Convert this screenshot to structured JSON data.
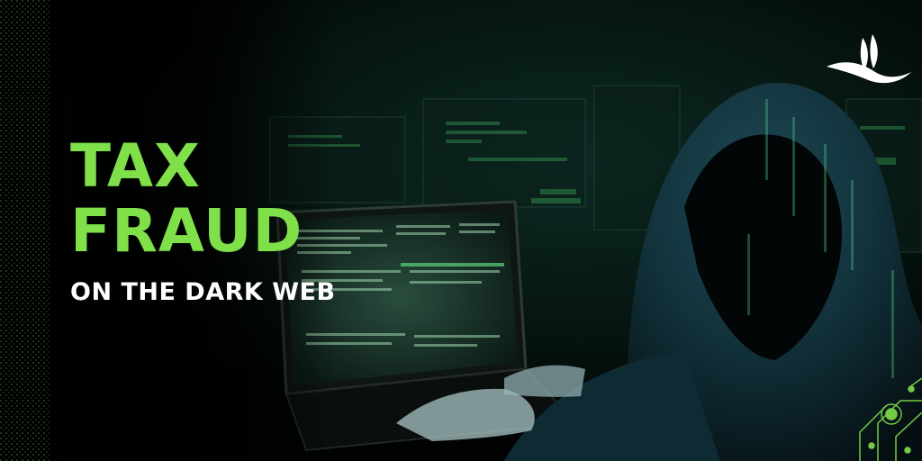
{
  "headline": {
    "line1": "TAX",
    "line2": "FRAUD"
  },
  "subheadline": "ON THE DARK WEB",
  "colors": {
    "accent_green": "#7fe04a",
    "background": "#020604",
    "text_white": "#ffffff"
  },
  "icons": {
    "logo": "bird-feather-logo",
    "decoration": "circuit-lines"
  }
}
